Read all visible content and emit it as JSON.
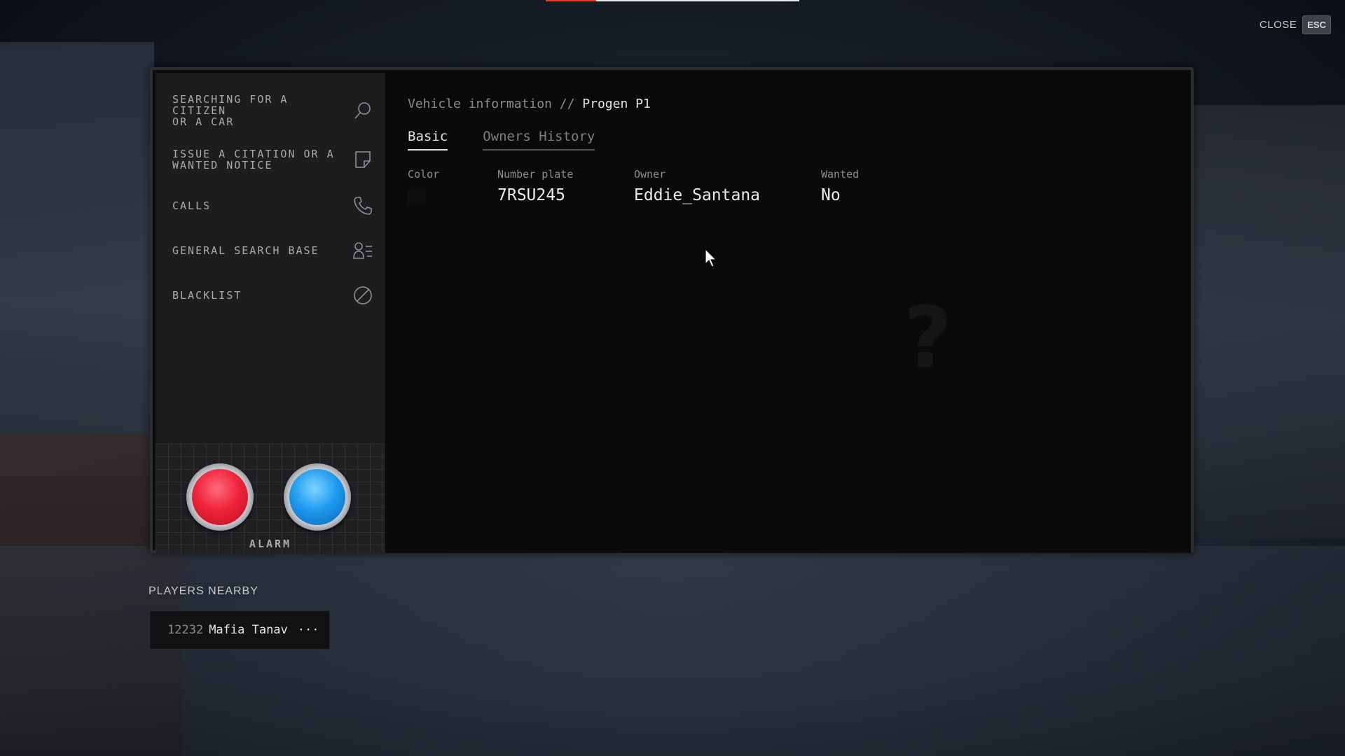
{
  "progress_bar": {
    "fraction": 0.2,
    "fill_color": "#d8452c",
    "track_color": "#e8e8e8"
  },
  "close": {
    "label": "CLOSE",
    "key": "ESC"
  },
  "sidebar": {
    "items": [
      {
        "label": "SEARCHING FOR A\nCITIZEN\nOR A CAR",
        "icon": "search-icon"
      },
      {
        "label": "ISSUE A CITATION OR A\nWANTED NOTICE",
        "icon": "note-icon"
      },
      {
        "label": "CALLS",
        "icon": "phone-icon"
      },
      {
        "label": "GENERAL SEARCH BASE",
        "icon": "person-list-icon"
      },
      {
        "label": "BLACKLIST",
        "icon": "blocked-icon"
      }
    ],
    "alarm": {
      "label": "ALARM",
      "red_color": "#f0243a",
      "blue_color": "#1f9cf0"
    }
  },
  "content": {
    "breadcrumb": {
      "section": "Vehicle information",
      "separator": "//",
      "vehicle": "Progen P1"
    },
    "tabs": [
      {
        "label": "Basic",
        "active": true
      },
      {
        "label": "Owners History",
        "active": false
      }
    ],
    "fields": {
      "color": {
        "label": "Color",
        "value_color": "#0e0e0e"
      },
      "plate": {
        "label": "Number plate",
        "value": "7RSU245"
      },
      "owner": {
        "label": "Owner",
        "value": "Eddie_Santana"
      },
      "wanted": {
        "label": "Wanted",
        "value": "No"
      }
    }
  },
  "players_nearby": {
    "title": "PLAYERS NEARBY",
    "players": [
      {
        "id": "12232",
        "name": "Mafia Tanav",
        "more": "···"
      }
    ]
  }
}
